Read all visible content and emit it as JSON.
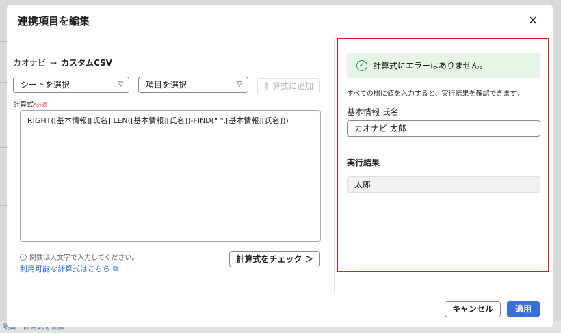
{
  "background": {
    "footer_text": "項目・計算式を編集"
  },
  "modal": {
    "title": "連携項目を編集",
    "close_icon": "close-icon"
  },
  "left": {
    "source": "カオナビ",
    "arrow": "→",
    "target": "カスタムCSV",
    "sheet_select": "シートを選択",
    "item_select": "項目を選択",
    "add_formula_button": "計算式に追加",
    "formula_label": "計算式",
    "required_mark": "*",
    "required_text": "必須",
    "formula_value": "RIGHT([基本情報][氏名],LEN([基本情報][氏名])-FIND(\" \",[基本情報][氏名]))",
    "hint": "関数は大文字で入力してください。",
    "help_link": "利用可能な計算式はこちら",
    "check_button": "計算式をチェック ＞"
  },
  "right": {
    "success_message": "計算式にエラーはありません。",
    "instruction": "すべての欄に値を入力すると、実行結果を確認できます。",
    "field_label": "基本情報 氏名",
    "field_value": "カオナビ 太郎",
    "result_label": "実行結果",
    "result_value": "太郎"
  },
  "footer": {
    "cancel": "キャンセル",
    "apply": "適用"
  },
  "colors": {
    "accent": "#3b6fd6",
    "highlight_border": "#e01b24",
    "success_bg": "#e6f5e6",
    "success_icon": "#2e8b57",
    "link": "#2a6bd0"
  }
}
